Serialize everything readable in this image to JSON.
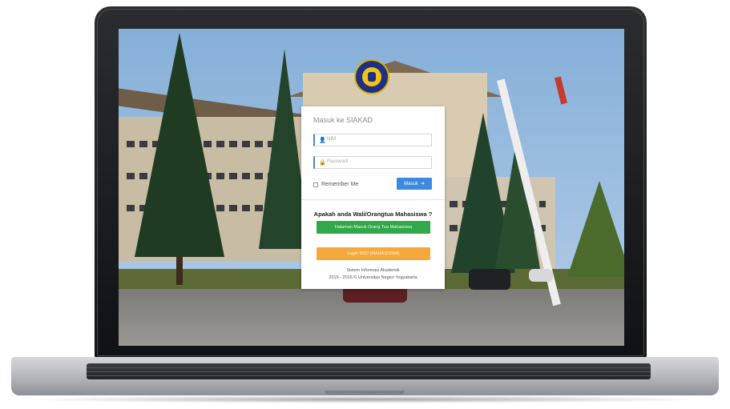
{
  "login": {
    "title": "Masuk ke SIAKAD",
    "username_icon": "user-icon",
    "username_placeholder": "NIM",
    "password_icon": "lock-icon",
    "password_placeholder": "Password",
    "remember_label": "Remember Me",
    "submit_label": "Masuk",
    "submit_icon": "sign-in-icon",
    "parent_question": "Apakah anda Wali/Orangtua Mahasiswa ?",
    "parent_button": "Halaman Masuk Orang Tua Mahasiswa",
    "sso_button": "Login SSO (MAHASISWA)",
    "footer_line1": "Sistem Informasi Akademik",
    "footer_line2": "2015 - 2016 © Universitas Negeri Yogyakarta"
  },
  "colors": {
    "primary_button": "#3d8ae3",
    "parent_button": "#31a94a",
    "sso_button": "#f5a93d",
    "logo_blue": "#1f2f86",
    "logo_gold": "#f0c419"
  }
}
